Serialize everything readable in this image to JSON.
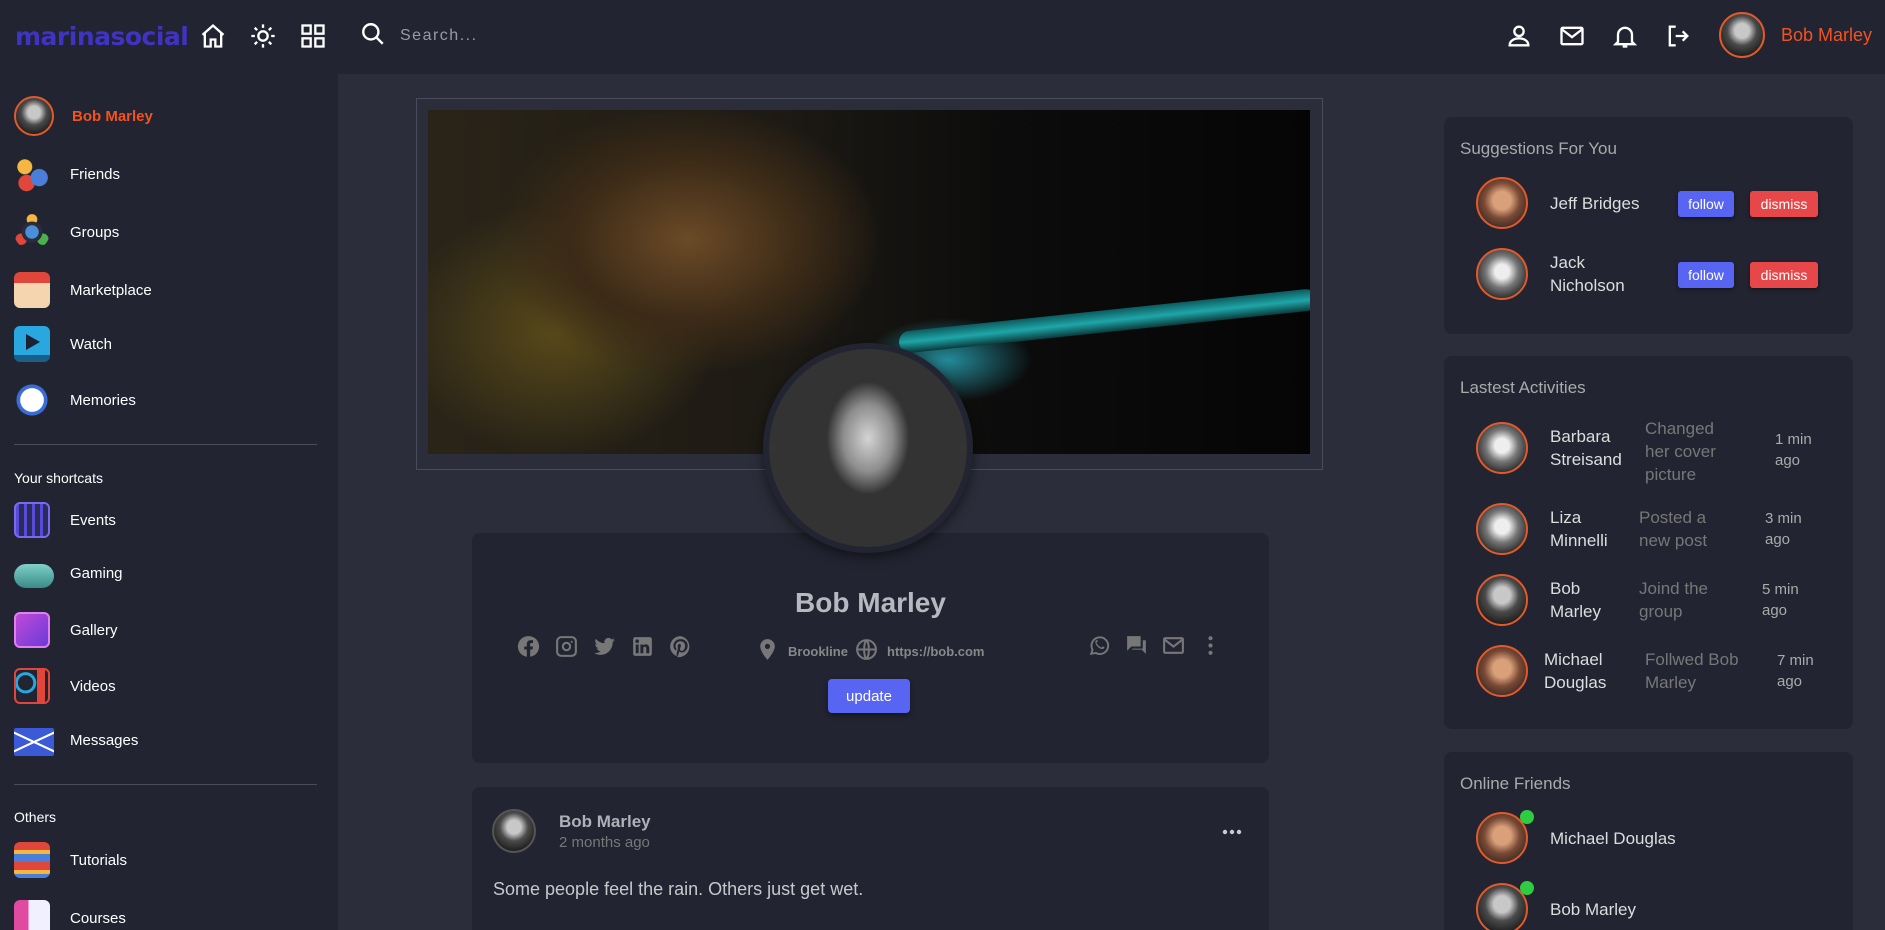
{
  "navbar": {
    "logo": "marinasocial",
    "search_placeholder": "Search...",
    "user_name": "Bob Marley",
    "icons": [
      "home-icon",
      "brightness-icon",
      "apps-grid-icon",
      "search-icon",
      "person-icon",
      "mail-icon",
      "bell-icon",
      "logout-icon"
    ]
  },
  "sidebar": {
    "user_name": "Bob Marley",
    "main_items": [
      {
        "label": "Friends",
        "icon": "friends-icon"
      },
      {
        "label": "Groups",
        "icon": "groups-icon"
      },
      {
        "label": "Marketplace",
        "icon": "marketplace-icon"
      },
      {
        "label": "Watch",
        "icon": "watch-icon"
      },
      {
        "label": "Memories",
        "icon": "memories-icon"
      }
    ],
    "shortcuts_heading": "Your shortcats",
    "shortcuts": [
      {
        "label": "Events",
        "icon": "events-icon"
      },
      {
        "label": "Gaming",
        "icon": "gaming-icon"
      },
      {
        "label": "Gallery",
        "icon": "gallery-icon"
      },
      {
        "label": "Videos",
        "icon": "videos-icon"
      },
      {
        "label": "Messages",
        "icon": "messages-icon"
      }
    ],
    "others_heading": "Others",
    "others": [
      {
        "label": "Tutorials",
        "icon": "tutorials-icon"
      },
      {
        "label": "Courses",
        "icon": "courses-icon"
      }
    ]
  },
  "profile": {
    "name": "Bob Marley",
    "location": "Brookline",
    "website": "https://bob.com",
    "update_label": "update"
  },
  "post": {
    "author": "Bob Marley",
    "time": "2 months ago",
    "text": "Some people feel the rain. Others just get wet."
  },
  "suggestions": {
    "title": "Suggestions For You",
    "follow_label": "follow",
    "dismiss_label": "dismiss",
    "items": [
      {
        "name": "Jeff Bridges"
      },
      {
        "name": "Jack Nicholson"
      }
    ]
  },
  "activities": {
    "title": "Lastest Activities",
    "items": [
      {
        "name": "Barbara Streisand",
        "desc": "Changed her cover picture",
        "time": "1 min ago"
      },
      {
        "name": "Liza Minnelli",
        "desc": "Posted a new post",
        "time": "3 min ago"
      },
      {
        "name": "Bob Marley",
        "desc": "Joind the group",
        "time": "5 min ago"
      },
      {
        "name": "Michael Douglas",
        "desc": "Follwed Bob Marley",
        "time": "7 min ago"
      }
    ]
  },
  "online_friends": {
    "title": "Online Friends",
    "items": [
      {
        "name": "Michael Douglas"
      },
      {
        "name": "Bob Marley"
      }
    ]
  },
  "colors": {
    "background": "#2b2d3a",
    "panel": "#222431",
    "accent_orange": "#f4521f",
    "logo_blue": "#3f34c2",
    "button_blue": "#5865f2",
    "button_red": "#e8474a",
    "online_green": "#2ecc40"
  }
}
